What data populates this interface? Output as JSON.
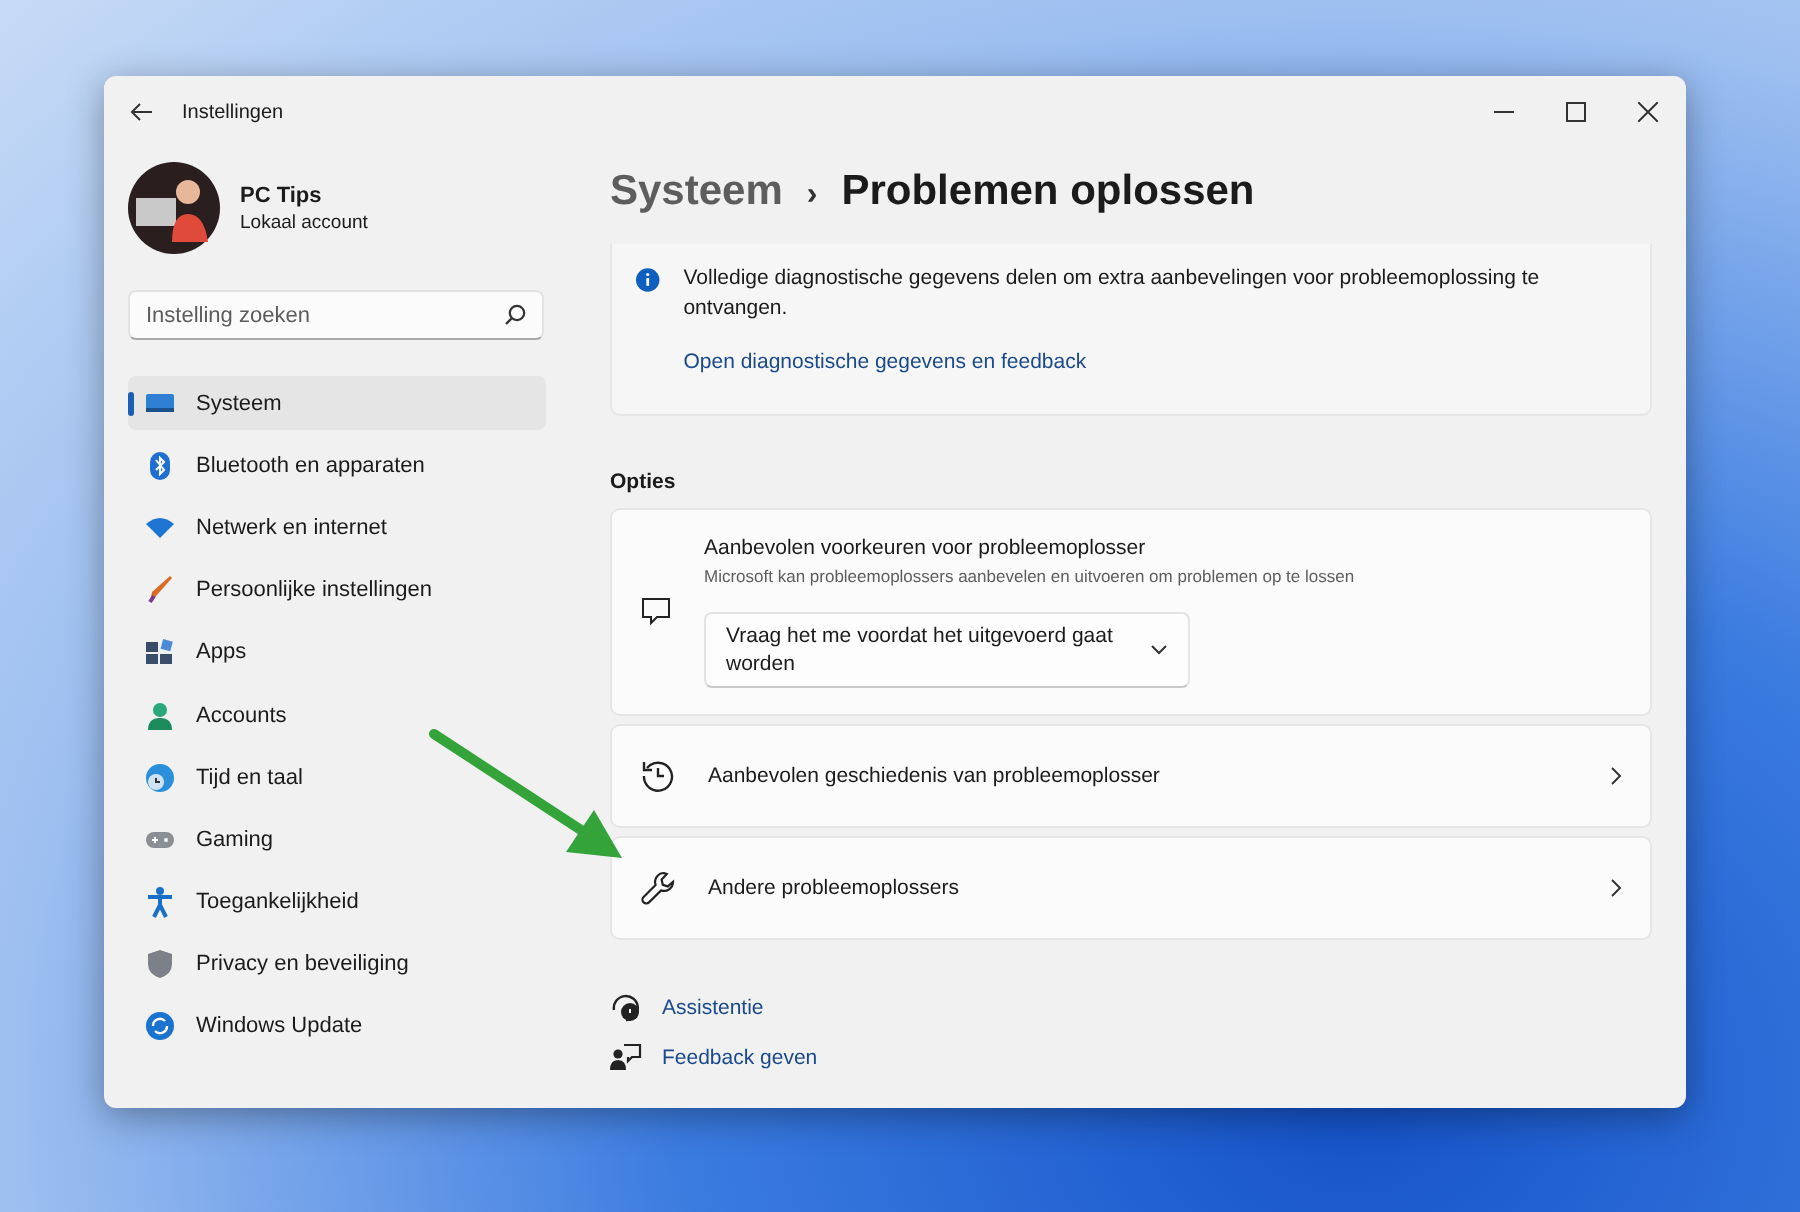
{
  "window": {
    "title": "Instellingen"
  },
  "account": {
    "name": "PC Tips",
    "type": "Lokaal account"
  },
  "search": {
    "placeholder": "Instelling zoeken"
  },
  "sidebar": {
    "items": [
      {
        "label": "Systeem",
        "selected": true
      },
      {
        "label": "Bluetooth en apparaten",
        "selected": false
      },
      {
        "label": "Netwerk en internet",
        "selected": false
      },
      {
        "label": "Persoonlijke instellingen",
        "selected": false
      },
      {
        "label": "Apps",
        "selected": false
      },
      {
        "label": "Accounts",
        "selected": false
      },
      {
        "label": "Tijd en taal",
        "selected": false
      },
      {
        "label": "Gaming",
        "selected": false
      },
      {
        "label": "Toegankelijkheid",
        "selected": false
      },
      {
        "label": "Privacy en beveiliging",
        "selected": false
      },
      {
        "label": "Windows Update",
        "selected": false
      }
    ]
  },
  "breadcrumb": {
    "parent": "Systeem",
    "separator": "›",
    "current": "Problemen oplossen"
  },
  "info_card": {
    "text": "Volledige diagnostische gegevens delen om extra aanbevelingen voor probleemoplossing te ontvangen.",
    "link": "Open diagnostische gegevens en feedback"
  },
  "section_title": "Opties",
  "cards": [
    {
      "kind": "dropdown",
      "title": "Aanbevolen voorkeuren voor probleemoplosser",
      "subtitle": "Microsoft kan probleemoplossers aanbevelen en uitvoeren om problemen op te lossen",
      "value": "Vraag het me voordat het uitgevoerd gaat worden"
    },
    {
      "kind": "link",
      "title": "Aanbevolen geschiedenis van probleemoplosser"
    },
    {
      "kind": "link",
      "title": "Andere probleemoplossers"
    }
  ],
  "footer_links": [
    "Assistentie",
    "Feedback geven"
  ]
}
